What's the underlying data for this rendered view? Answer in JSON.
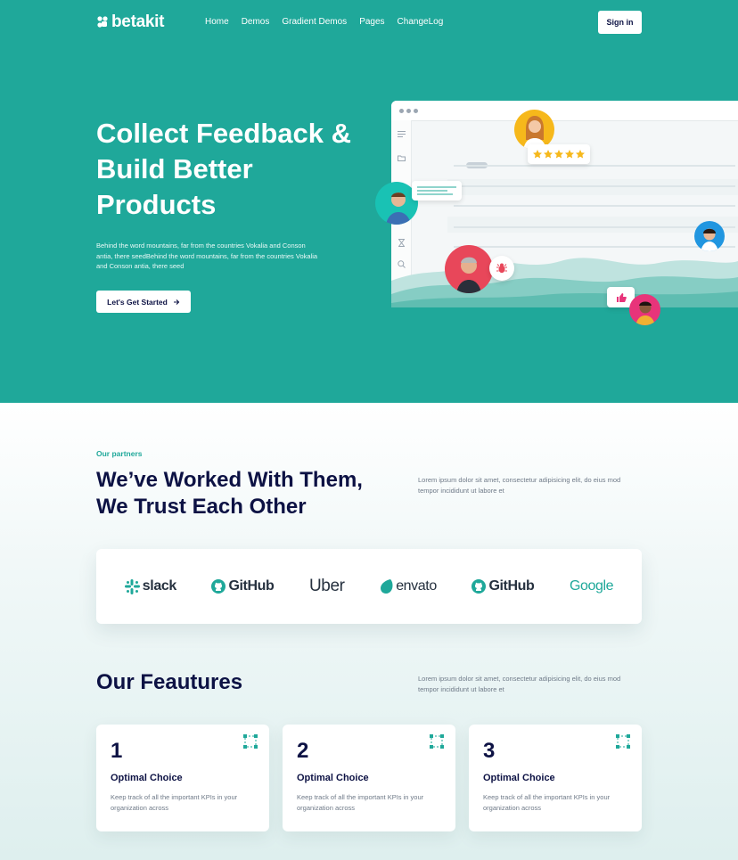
{
  "nav": {
    "logo": "betakit",
    "items": [
      "Home",
      "Demos",
      "Gradient Demos",
      "Pages",
      "ChangeLog"
    ],
    "signin": "Sign in"
  },
  "hero": {
    "title_lines": [
      "Collect Feedback &",
      "Build Better",
      "Products"
    ],
    "description": "Behind the word mountains, far from the countries Vokalia and Conson antia, there seedBehind the word mountains, far from the countries Vokalia and Conson antia, there seed",
    "cta": "Let's Get Started"
  },
  "partners": {
    "eyebrow": "Our partners",
    "title_lines": [
      "We’ve Worked With Them,",
      "We Trust Each Other"
    ],
    "text": "Lorem ipsum dolor sit amet, consectetur adipisicing elit, do eius mod tempor incididunt ut labore et",
    "logos": [
      "slack",
      "GitHub",
      "Uber",
      "envato",
      "GitHub",
      "Google"
    ]
  },
  "features": {
    "title": "Our Feautures",
    "text": "Lorem ipsum dolor sit amet, consectetur adipisicing elit, do eius mod tempor incididunt ut labore et",
    "cards": [
      {
        "num": "1",
        "title": "Optimal Choice",
        "desc": "Keep track of all the important KPIs in your organization across"
      },
      {
        "num": "2",
        "title": "Optimal Choice",
        "desc": "Keep track of all the important KPIs in your organization across"
      },
      {
        "num": "3",
        "title": "Optimal Choice",
        "desc": "Keep track of all the important KPIs in your organization across"
      }
    ]
  },
  "colors": {
    "brand": "#1fa89a",
    "navy": "#0d1244",
    "star": "#f6b81b",
    "accent_red": "#e8475a"
  }
}
